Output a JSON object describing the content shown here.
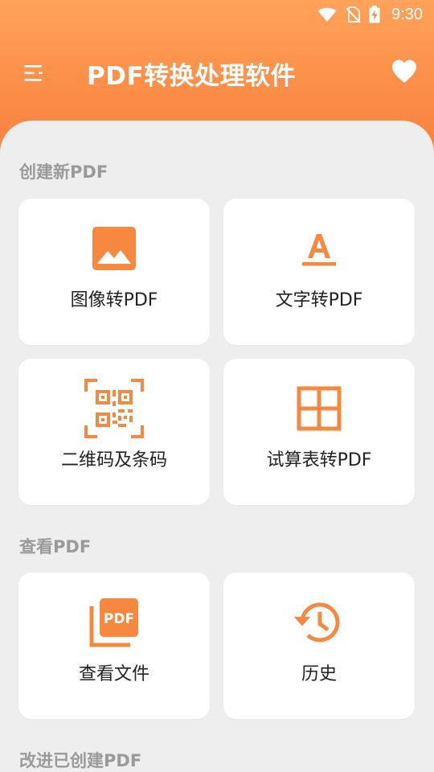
{
  "status": {
    "time": "9:30"
  },
  "app": {
    "title": "PDF转换处理软件"
  },
  "colors": {
    "accent": "#F7883F",
    "header_top": "#FFA25A",
    "header_bottom": "#F77B3B",
    "background": "#EEEEEE"
  },
  "sections": [
    {
      "title": "创建新PDF",
      "items": [
        {
          "label": "图像转PDF",
          "icon": "image-icon"
        },
        {
          "label": "文字转PDF",
          "icon": "text-a-icon"
        },
        {
          "label": "二维码及条码",
          "icon": "qr-code-icon"
        },
        {
          "label": "试算表转PDF",
          "icon": "spreadsheet-grid-icon"
        }
      ]
    },
    {
      "title": "查看PDF",
      "items": [
        {
          "label": "查看文件",
          "icon": "pdf-file-icon"
        },
        {
          "label": "历史",
          "icon": "history-icon"
        }
      ]
    },
    {
      "title": "改进已创建PDF",
      "items": []
    }
  ],
  "pdf_icon_text": "PDF"
}
